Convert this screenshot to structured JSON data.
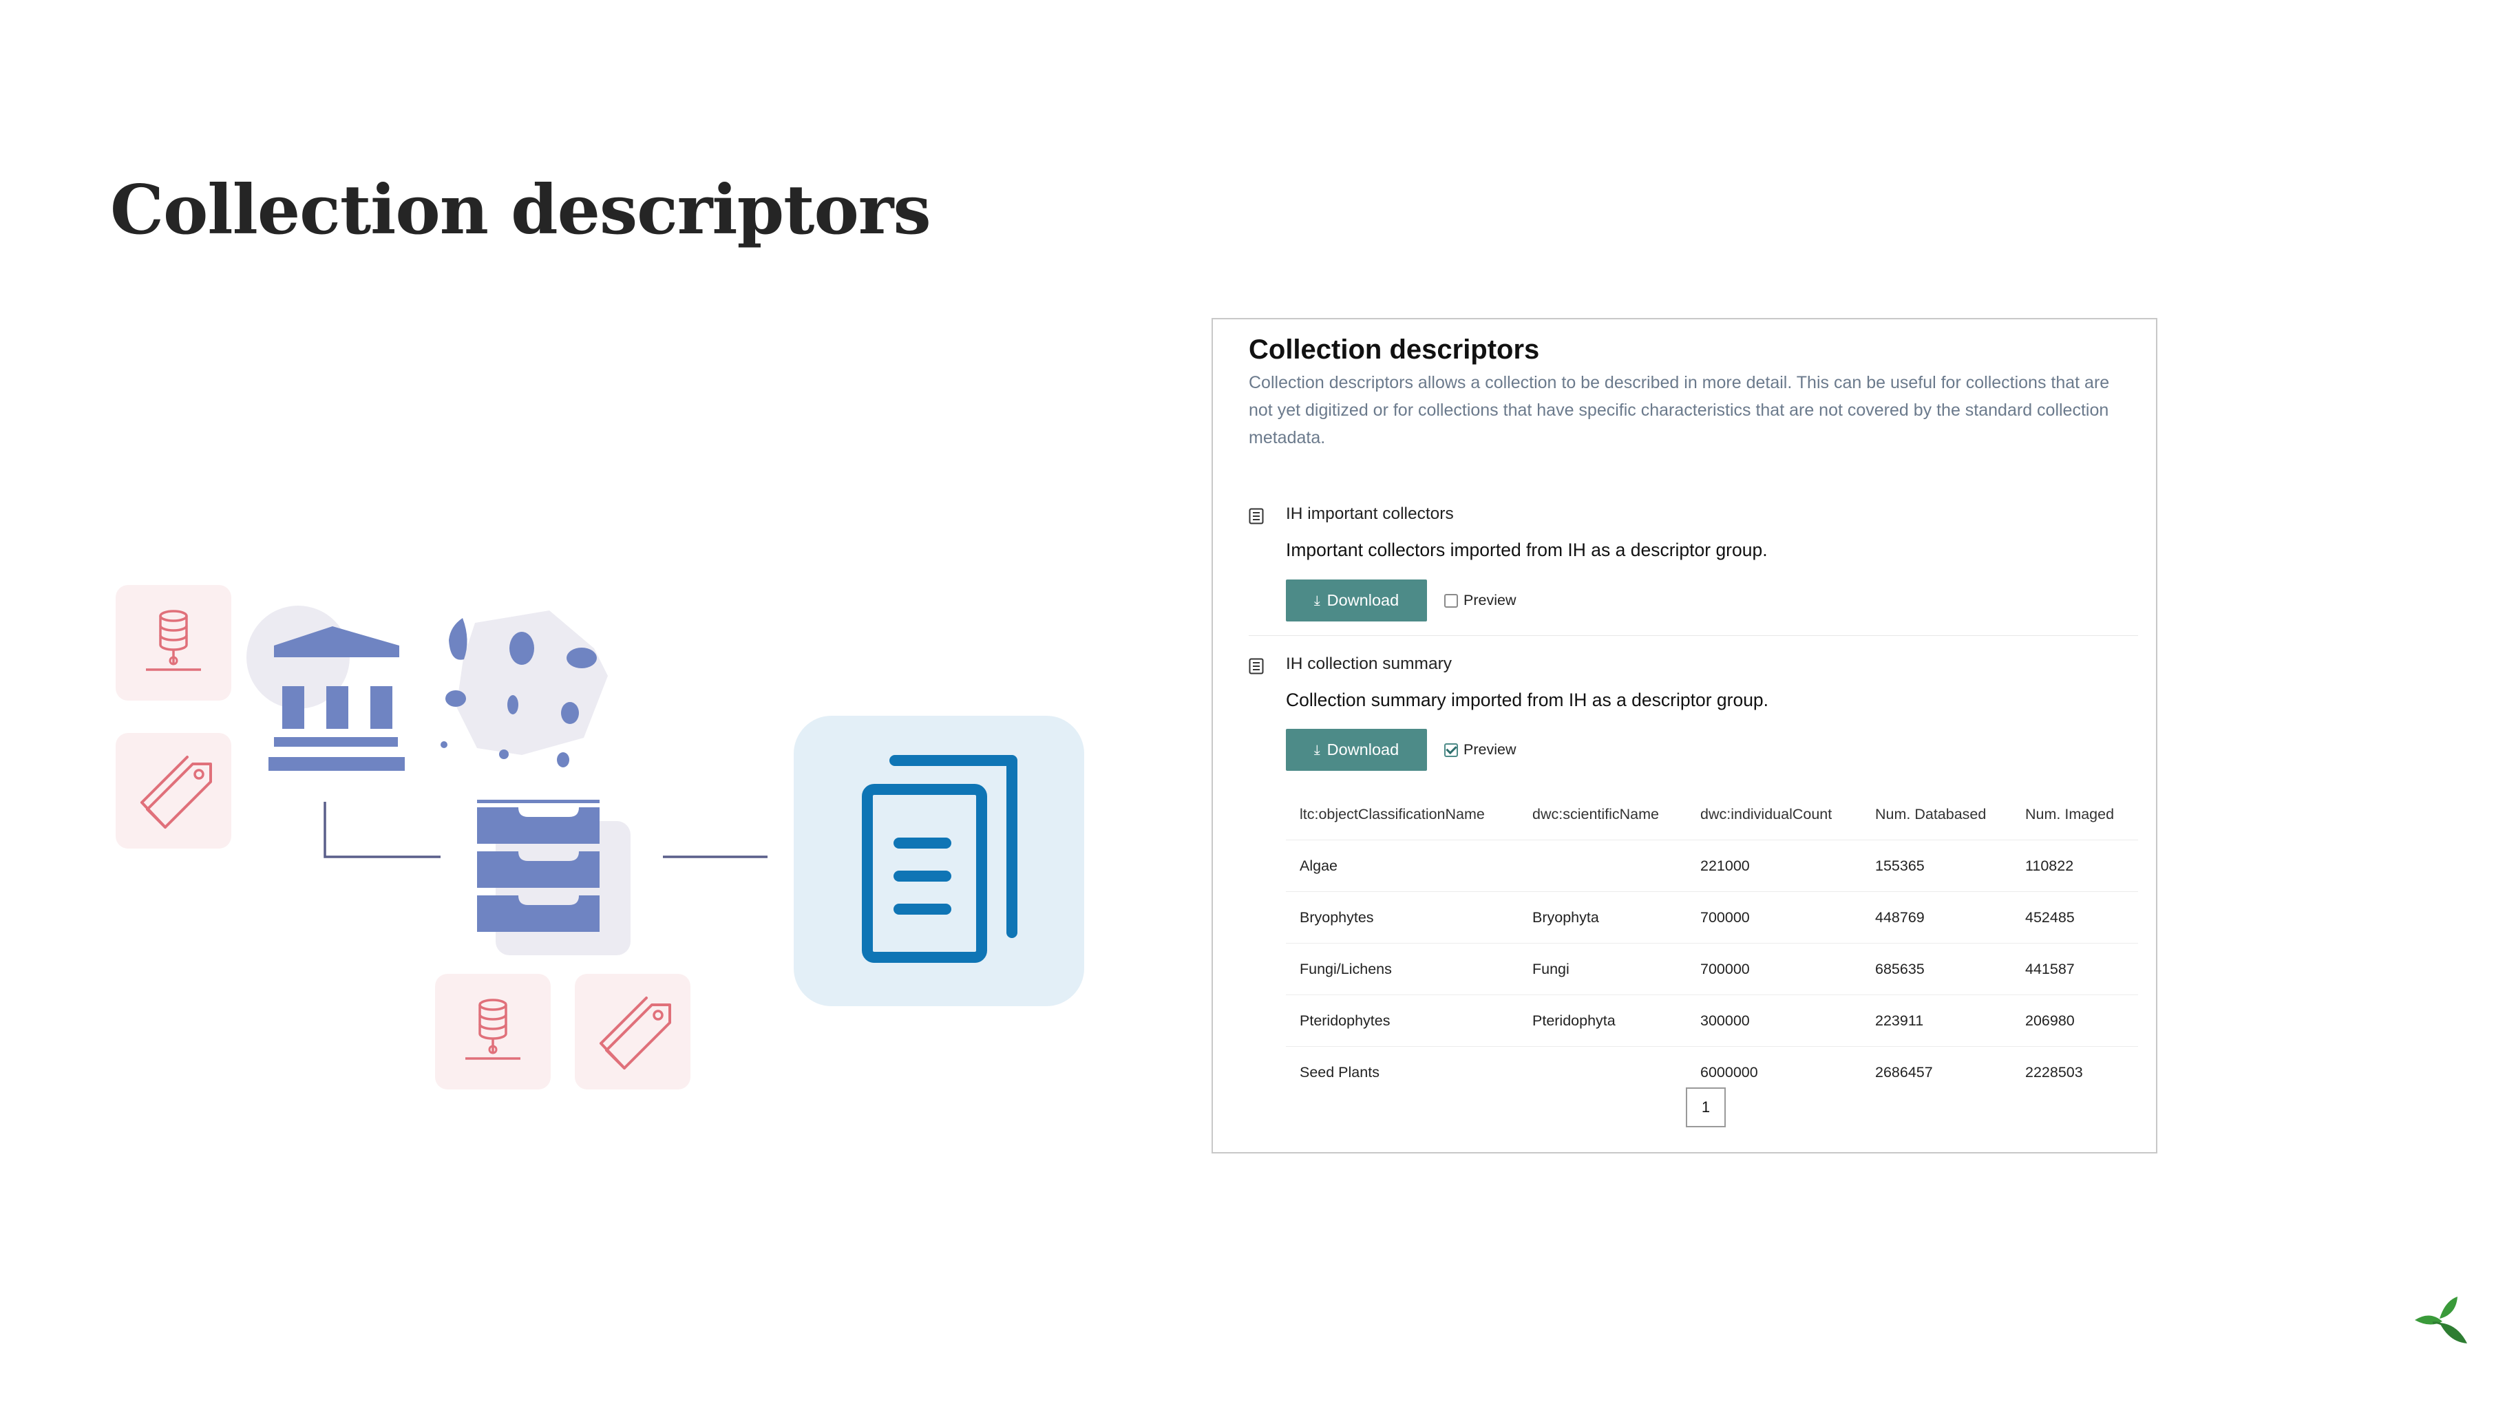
{
  "slide": {
    "title": "Collection descriptors"
  },
  "panel": {
    "title": "Collection descriptors",
    "description": "Collection descriptors allows a collection to be described in more detail. This can be useful for collections that are not yet digitized or for collections that have specific characteristics that are not covered by the standard collection metadata.",
    "groups": [
      {
        "title": "IH important collectors",
        "description": "Important collectors imported from IH as a descriptor group.",
        "download_label": "Download",
        "preview_label": "Preview",
        "preview_checked": false
      },
      {
        "title": "IH collection summary",
        "description": "Collection summary imported from IH as a descriptor group.",
        "download_label": "Download",
        "preview_label": "Preview",
        "preview_checked": true
      }
    ],
    "table": {
      "headers": [
        "ltc:objectClassificationName",
        "dwc:scientificName",
        "dwc:individualCount",
        "Num. Databased",
        "Num. Imaged"
      ],
      "rows": [
        [
          "Algae",
          "",
          "221000",
          "155365",
          "110822"
        ],
        [
          "Bryophytes",
          "Bryophyta",
          "700000",
          "448769",
          "452485"
        ],
        [
          "Fungi/Lichens",
          "Fungi",
          "700000",
          "685635",
          "441587"
        ],
        [
          "Pteridophytes",
          "Pteridophyta",
          "300000",
          "223911",
          "206980"
        ],
        [
          "Seed Plants",
          "",
          "6000000",
          "2686457",
          "2228503"
        ]
      ]
    },
    "pagination": {
      "current_page": "1"
    }
  },
  "colors": {
    "accent_teal": "#4d8b88",
    "illustration_blue": "#6f84c2",
    "document_blue": "#0f75b5",
    "tile_pink": "#fbeff0",
    "icon_red": "#e0707a",
    "leaf_green": "#3a9a3a"
  },
  "icons": [
    "database-icon",
    "tag-icon",
    "museum-building-icon",
    "specimen-blob-icon",
    "drawer-cabinet-icon",
    "document-copy-icon",
    "table-list-icon",
    "download-arrow-icon",
    "leaf-logo-icon"
  ]
}
